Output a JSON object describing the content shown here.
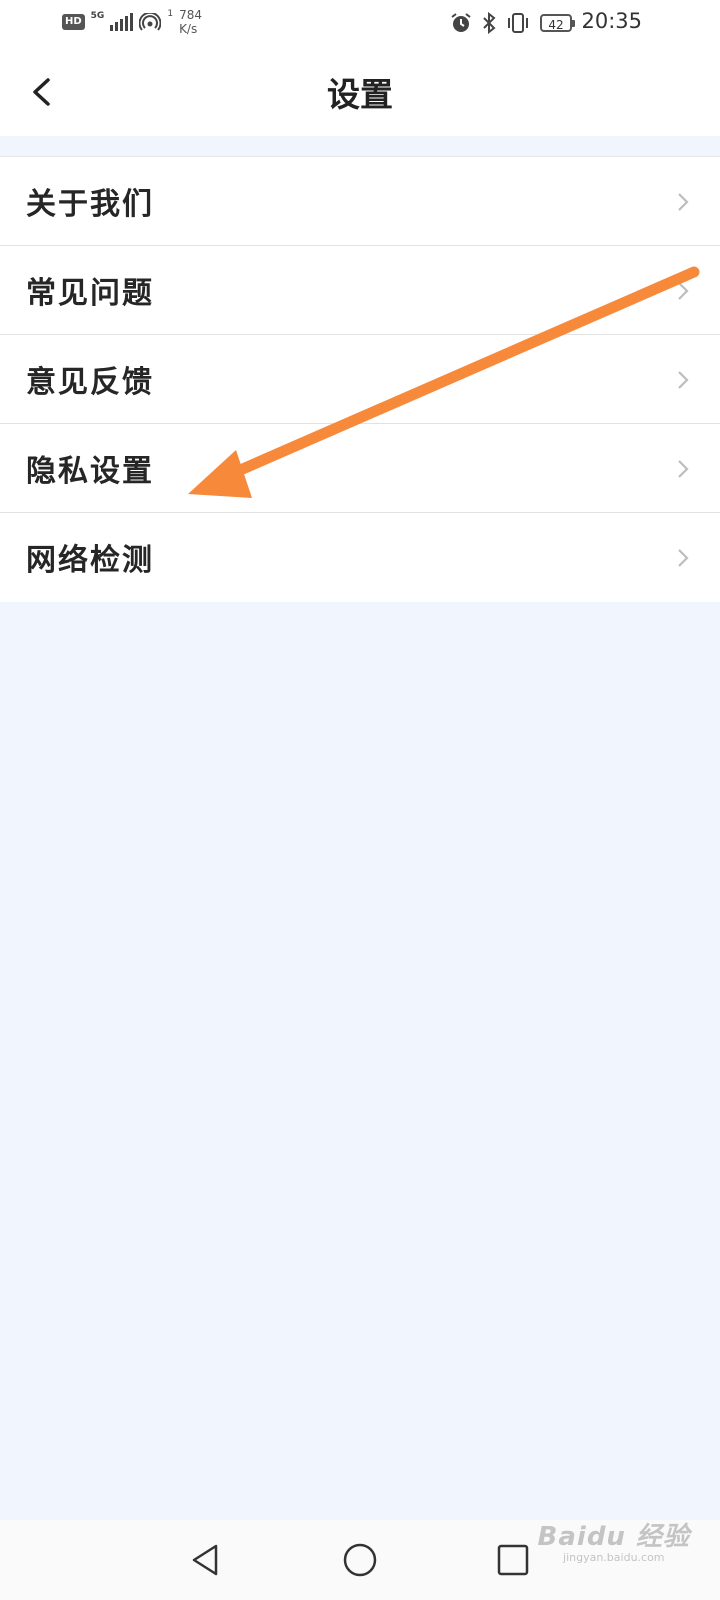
{
  "status_bar": {
    "hd": "HD",
    "network": "5G",
    "sub_index": "1",
    "speed_value": "784",
    "speed_unit": "K/s",
    "battery": "42",
    "time": "20:35"
  },
  "header": {
    "title": "设置",
    "back_icon": "chevron-left-icon"
  },
  "menu": {
    "items": [
      {
        "label": "关于我们"
      },
      {
        "label": "常见问题"
      },
      {
        "label": "意见反馈"
      },
      {
        "label": "隐私设置"
      },
      {
        "label": "网络检测"
      }
    ]
  },
  "annotation": {
    "color": "#f7893a",
    "points_to": "隐私设置"
  },
  "nav_bar": {
    "back_icon": "triangle-back-icon",
    "home_icon": "circle-home-icon",
    "recents_icon": "square-recents-icon"
  },
  "watermark": {
    "main": "Baidu 经验",
    "sub": "jingyan.baidu.com"
  }
}
